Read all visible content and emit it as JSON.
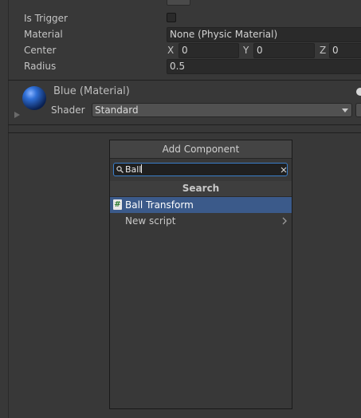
{
  "collider": {
    "is_trigger_label": "Is Trigger",
    "material_label": "Material",
    "material_value": "None (Physic Material)",
    "center_label": "Center",
    "center": [
      {
        "axis": "X",
        "value": "0"
      },
      {
        "axis": "Y",
        "value": "0"
      },
      {
        "axis": "Z",
        "value": "0"
      }
    ],
    "radius_label": "Radius",
    "radius_value": "0.5"
  },
  "material": {
    "title": "Blue (Material)",
    "shader_label": "Shader",
    "shader_value": "Standard",
    "preview_color": "#1f5fbf"
  },
  "add_component": {
    "header": "Add Component",
    "search_value": "Ball",
    "section_title": "Search",
    "items": [
      {
        "label": "Ball Transform",
        "icon": "script-icon",
        "selected": true
      },
      {
        "label": "New script",
        "icon": "chevron-right-icon",
        "selected": false
      }
    ],
    "accent": "#3b5a8a"
  }
}
